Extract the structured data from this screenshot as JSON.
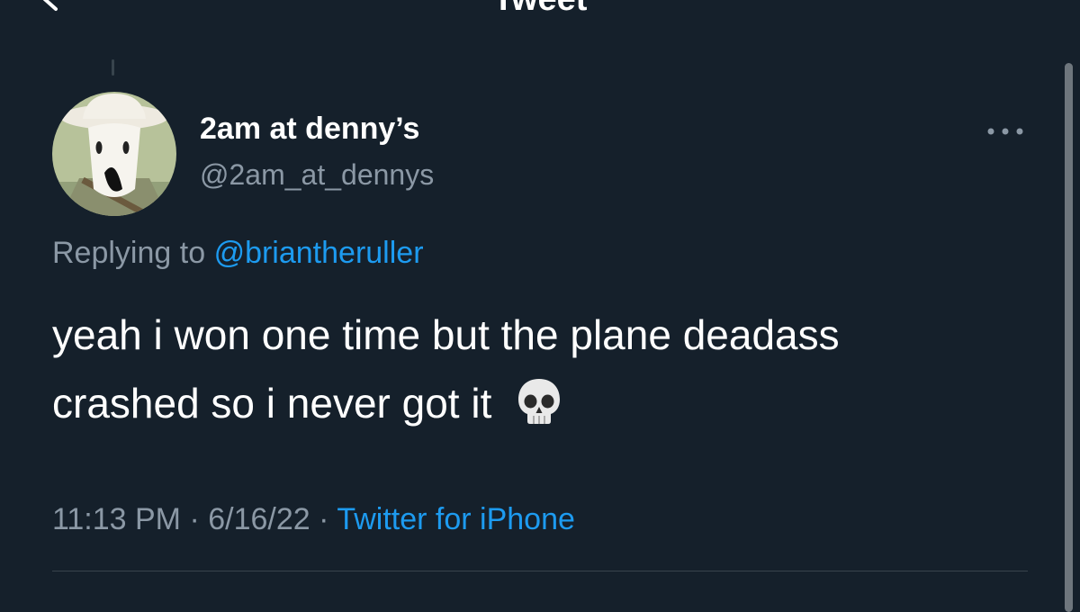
{
  "header": {
    "title": "Tweet",
    "back_icon": "arrow-left-icon"
  },
  "tweet": {
    "author": {
      "display_name": "2am at denny’s",
      "handle": "@2am_at_dennys",
      "avatar_icon": "avatar-cartoon"
    },
    "reply": {
      "prefix": "Replying to",
      "mention": "@briantheruller"
    },
    "text": "yeah i won one time but the plane deadass crashed so i never got it",
    "emoji_icon": "skull-emoji-icon",
    "time": "11:13 PM",
    "date": "6/16/22",
    "source": "Twitter for iPhone",
    "separator": "·",
    "more_icon": "more-horizontal-icon"
  },
  "colors": {
    "background": "#15202b",
    "primary_text": "#ffffff",
    "secondary_text": "#8b98a5",
    "accent": "#1d9bf0",
    "divider": "#38444d"
  }
}
